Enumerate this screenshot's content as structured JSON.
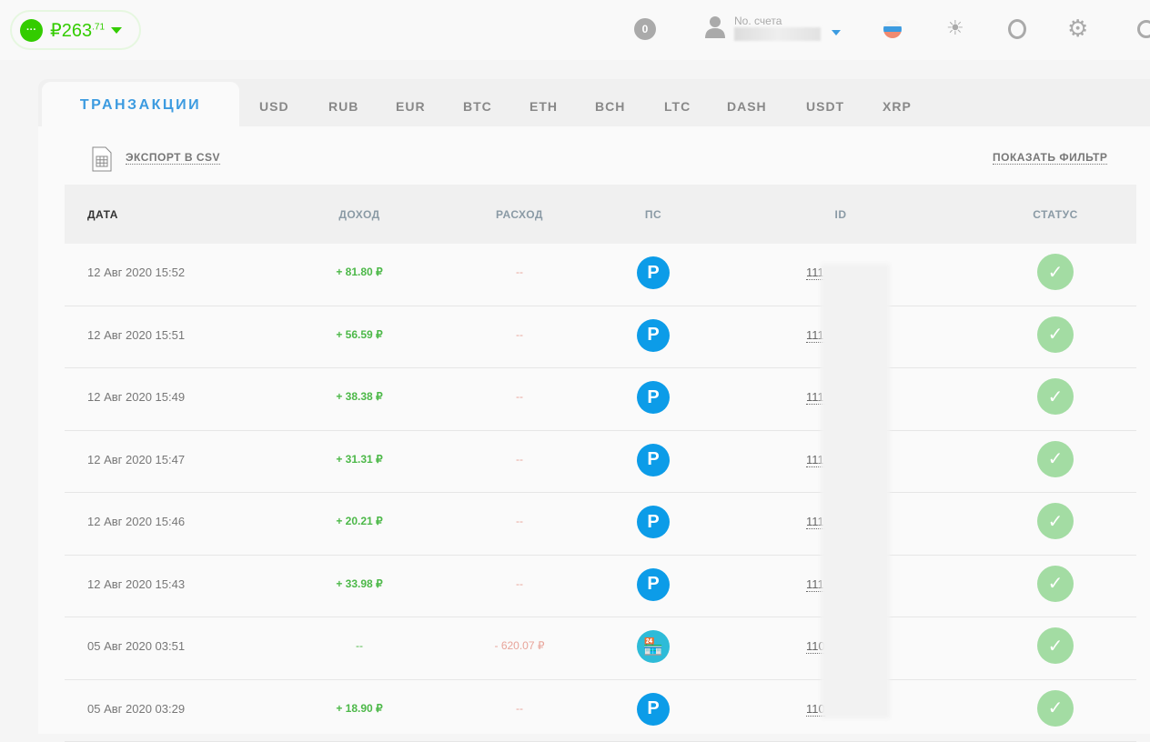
{
  "balance": {
    "currency": "₽",
    "whole": "263",
    "fraction": ".71"
  },
  "header": {
    "notifications": "0",
    "account_label": "No. счета"
  },
  "tabs": [
    "ТРАНЗАКЦИИ",
    "USD",
    "RUB",
    "EUR",
    "BTC",
    "ETH",
    "BCH",
    "LTC",
    "DASH",
    "USDT",
    "XRP"
  ],
  "actions": {
    "export": "ЭКСПОРТ В CSV",
    "filter": "ПОКАЗАТЬ ФИЛЬТР"
  },
  "columns": [
    "ДАТА",
    "ДОХОД",
    "РАСХОД",
    "ПС",
    "ID",
    "СТАТУС"
  ],
  "rows": [
    {
      "date": "12 Авг 2020 15:52",
      "income": "+ 81.80 ₽",
      "expense": "--",
      "ps": "P",
      "id": "111"
    },
    {
      "date": "12 Авг 2020 15:51",
      "income": "+ 56.59 ₽",
      "expense": "--",
      "ps": "P",
      "id": "111"
    },
    {
      "date": "12 Авг 2020 15:49",
      "income": "+ 38.38 ₽",
      "expense": "--",
      "ps": "P",
      "id": "111"
    },
    {
      "date": "12 Авг 2020 15:47",
      "income": "+ 31.31 ₽",
      "expense": "--",
      "ps": "P",
      "id": "111"
    },
    {
      "date": "12 Авг 2020 15:46",
      "income": "+ 20.21 ₽",
      "expense": "--",
      "ps": "P",
      "id": "111"
    },
    {
      "date": "12 Авг 2020 15:43",
      "income": "+ 33.98 ₽",
      "expense": "--",
      "ps": "P",
      "id": "111"
    },
    {
      "date": "05 Авг 2020 03:51",
      "income": "--",
      "expense": "- 620.07 ₽",
      "ps": "shop",
      "id": "110"
    },
    {
      "date": "05 Авг 2020 03:29",
      "income": "+ 18.90 ₽",
      "expense": "--",
      "ps": "P",
      "id": "110"
    }
  ]
}
